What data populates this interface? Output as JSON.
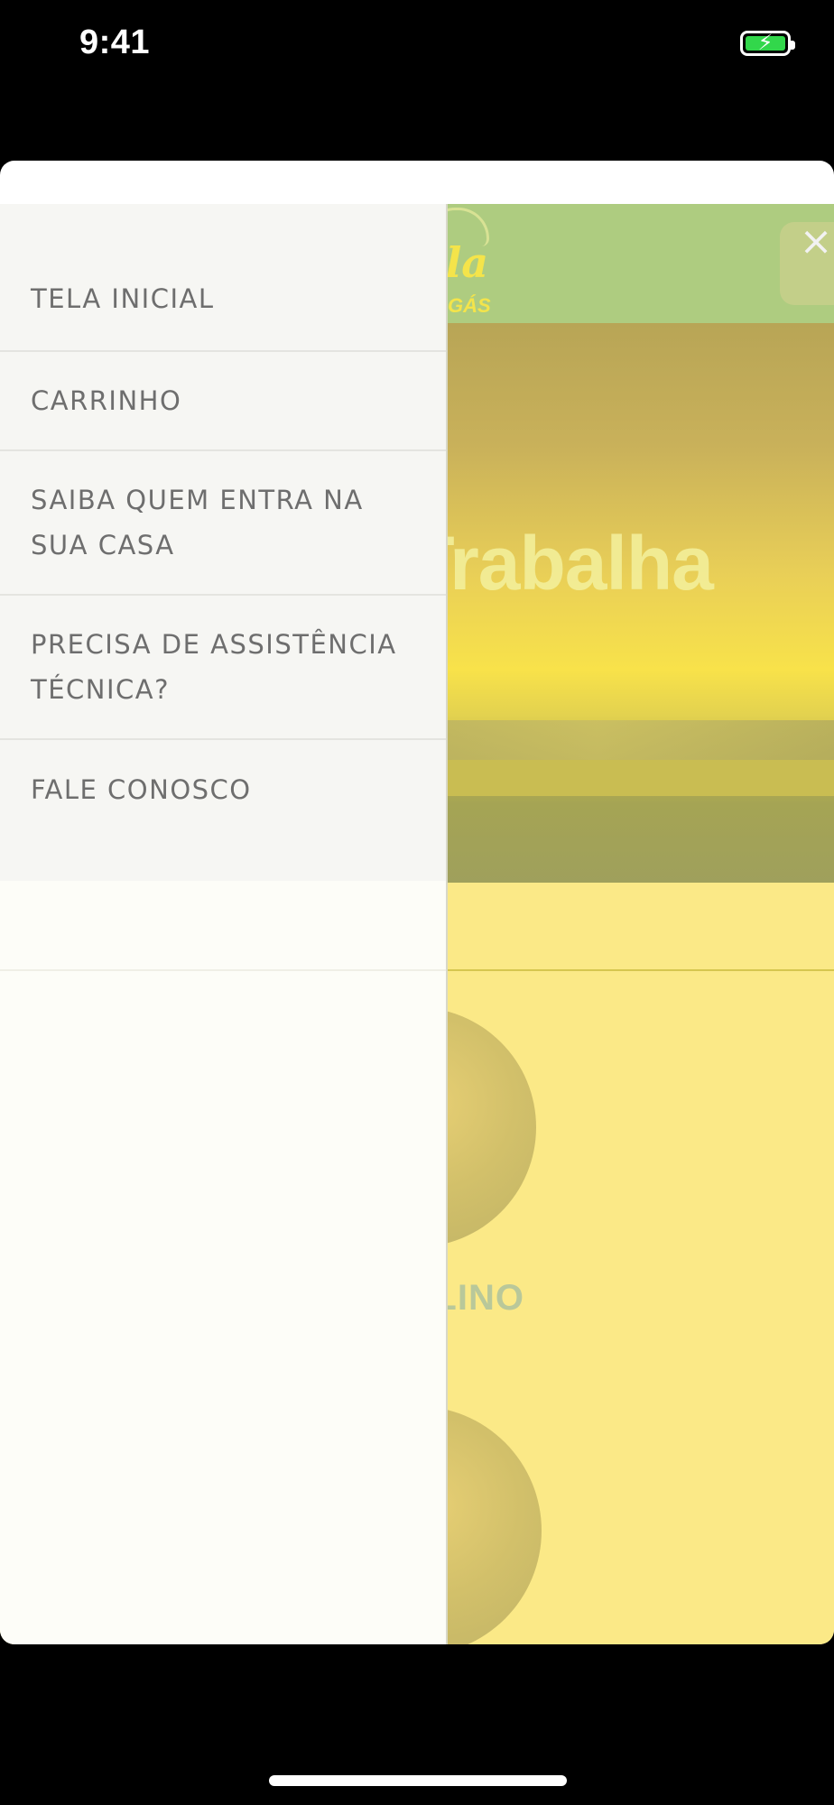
{
  "status_bar": {
    "time": "9:41",
    "battery_icon": "battery-charging-icon",
    "battery_color": "#32d74b"
  },
  "app": {
    "logo": {
      "word": "Villa",
      "sub": "GÁS"
    },
    "close_icon": "×",
    "banner": {
      "title": "Quem Trabalha"
    },
    "person": {
      "name": "JUSCELINO"
    },
    "colors": {
      "header": "#aecc80",
      "section": "#fbe987"
    }
  },
  "drawer": {
    "items": [
      {
        "label": "TELA INICIAL"
      },
      {
        "label": "CARRINHO"
      },
      {
        "label": "SAIBA QUEM ENTRA NA SUA CASA"
      },
      {
        "label": "PRECISA DE ASSISTÊNCIA TÉCNICA?"
      },
      {
        "label": "FALE CONOSCO"
      }
    ]
  }
}
